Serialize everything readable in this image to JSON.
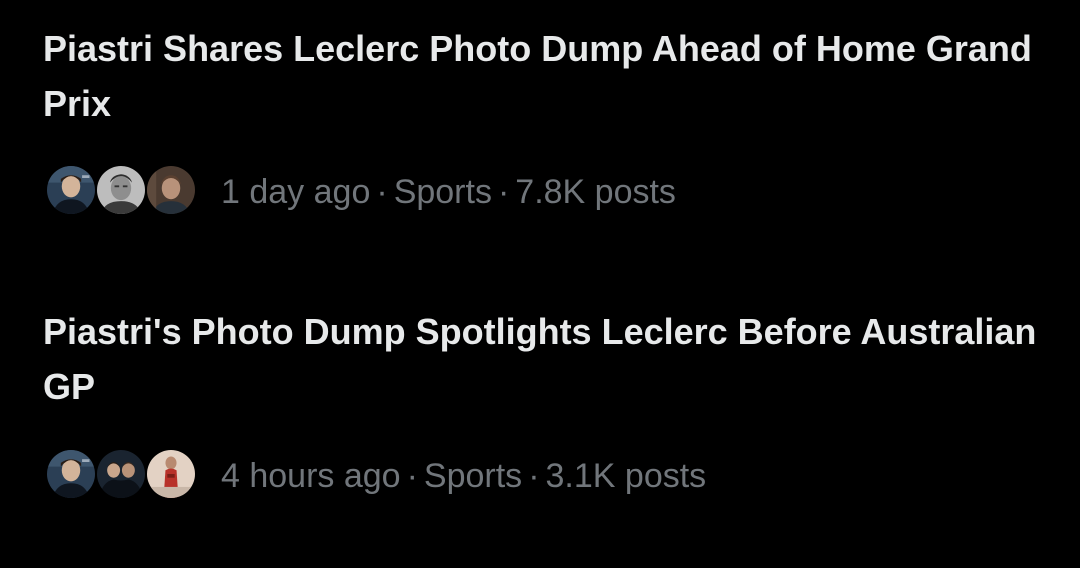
{
  "stories": [
    {
      "title": "Piastri Shares Leclerc Photo Dump Ahead of Home Grand Prix",
      "time": "1 day ago",
      "category": "Sports",
      "posts": "7.8K posts",
      "separator": "·",
      "avatars": [
        "leclerc-portrait",
        "driver-portrait-gray",
        "driver-portrait-helmet"
      ]
    },
    {
      "title": "Piastri's Photo Dump Spotlights Leclerc Before Australian GP",
      "time": "4 hours ago",
      "category": "Sports",
      "posts": "3.1K posts",
      "separator": "·",
      "avatars": [
        "leclerc-portrait",
        "team-group-photo",
        "driver-red-suit"
      ]
    }
  ],
  "colors": {
    "background": "#000000",
    "title": "#e7e9ea",
    "meta": "#71767b"
  }
}
